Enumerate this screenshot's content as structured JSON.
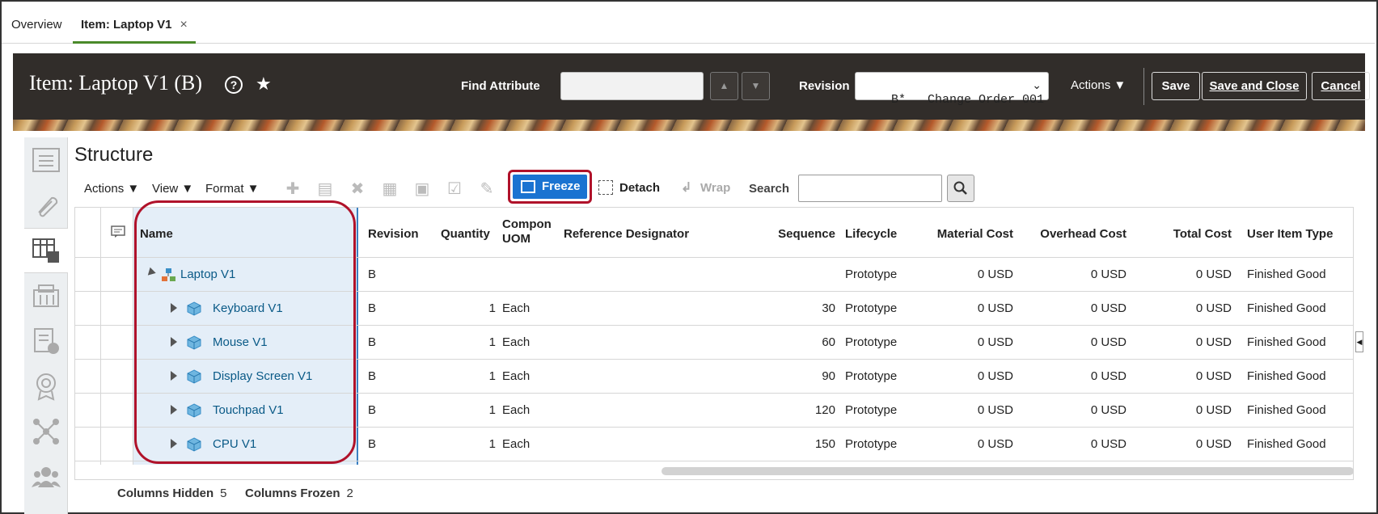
{
  "tabs": {
    "overview": "Overview",
    "item": "Item: Laptop V1",
    "close": "×"
  },
  "header": {
    "title": "Item: Laptop V1 (B)",
    "help": "?",
    "star": "★",
    "find_attribute_label": "Find Attribute",
    "find_attribute_value": "",
    "revision_label": "Revision",
    "revision_value": "B*   Change Order 001",
    "actions": "Actions ▼",
    "save": "Save",
    "save_and_close": "Save and Close",
    "cancel": "Cancel"
  },
  "structure": {
    "title": "Structure",
    "menus": {
      "actions": "Actions ▼",
      "view": "View ▼",
      "format": "Format ▼"
    },
    "freeze": "Freeze",
    "detach": "Detach",
    "wrap": "Wrap",
    "search_label": "Search",
    "search_value": ""
  },
  "table": {
    "columns": {
      "name": "Name",
      "revision": "Revision",
      "quantity": "Quantity",
      "component_uom_1": "Compon",
      "component_uom_2": "UOM",
      "reference_designator": "Reference Designator",
      "sequence": "Sequence",
      "lifecycle": "Lifecycle",
      "material_cost": "Material Cost",
      "overhead_cost": "Overhead Cost",
      "total_cost": "Total Cost",
      "user_item_type": "User Item Type"
    },
    "rows": [
      {
        "name": "Laptop V1",
        "revision": "B",
        "quantity": "",
        "uom": "",
        "sequence": "",
        "lifecycle": "Prototype",
        "material_cost": "0 USD",
        "overhead_cost": "0 USD",
        "total_cost": "0 USD",
        "user_item_type": "Finished Good"
      },
      {
        "name": "Keyboard V1",
        "revision": "B",
        "quantity": "1",
        "uom": "Each",
        "sequence": "30",
        "lifecycle": "Prototype",
        "material_cost": "0 USD",
        "overhead_cost": "0 USD",
        "total_cost": "0 USD",
        "user_item_type": "Finished Good"
      },
      {
        "name": "Mouse V1",
        "revision": "B",
        "quantity": "1",
        "uom": "Each",
        "sequence": "60",
        "lifecycle": "Prototype",
        "material_cost": "0 USD",
        "overhead_cost": "0 USD",
        "total_cost": "0 USD",
        "user_item_type": "Finished Good"
      },
      {
        "name": "Display Screen V1",
        "revision": "B",
        "quantity": "1",
        "uom": "Each",
        "sequence": "90",
        "lifecycle": "Prototype",
        "material_cost": "0 USD",
        "overhead_cost": "0 USD",
        "total_cost": "0 USD",
        "user_item_type": "Finished Good"
      },
      {
        "name": "Touchpad V1",
        "revision": "B",
        "quantity": "1",
        "uom": "Each",
        "sequence": "120",
        "lifecycle": "Prototype",
        "material_cost": "0 USD",
        "overhead_cost": "0 USD",
        "total_cost": "0 USD",
        "user_item_type": "Finished Good"
      },
      {
        "name": "CPU V1",
        "revision": "B",
        "quantity": "1",
        "uom": "Each",
        "sequence": "150",
        "lifecycle": "Prototype",
        "material_cost": "0 USD",
        "overhead_cost": "0 USD",
        "total_cost": "0 USD",
        "user_item_type": "Finished Good"
      }
    ]
  },
  "footer": {
    "columns_hidden_label": "Columns Hidden",
    "columns_hidden_value": "5",
    "columns_frozen_label": "Columns Frozen",
    "columns_frozen_value": "2"
  },
  "colors": {
    "header_bg": "#312d2a",
    "accent_blue": "#1a73d1",
    "highlight_red": "#b0122a",
    "link": "#0a5a87",
    "frozen_bg": "#e4eef8"
  },
  "icons": [
    "help-icon",
    "star-icon",
    "up-arrow-icon",
    "down-arrow-icon",
    "chevron-down-icon",
    "freeze-icon",
    "detach-icon",
    "wrap-icon",
    "search-icon",
    "structure-icon",
    "cube-icon"
  ]
}
